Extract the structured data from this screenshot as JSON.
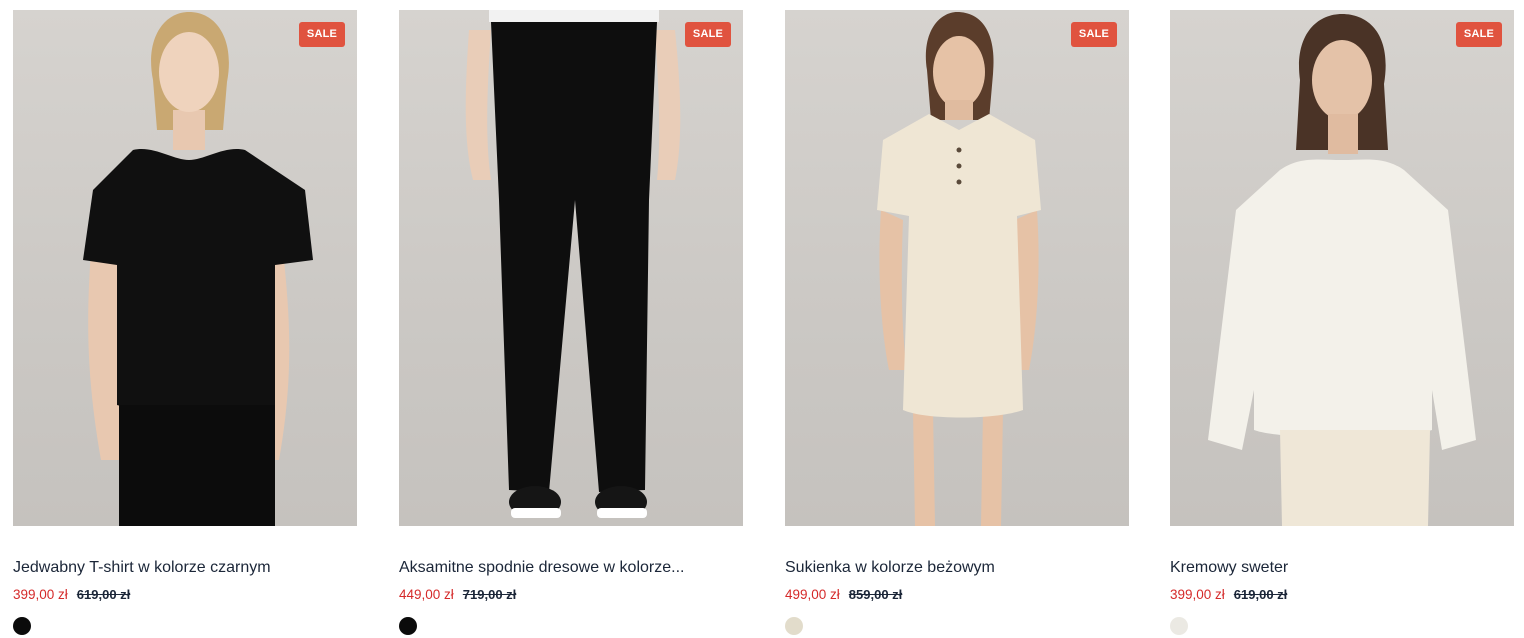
{
  "products": [
    {
      "badge": "SALE",
      "name": "Jedwabny T-shirt w kolorze czarnym",
      "price_current": "399,00 zł",
      "price_old": "619,00 zł",
      "swatch_color": "#0b0b0b"
    },
    {
      "badge": "SALE",
      "name": "Aksamitne spodnie dresowe w kolorze...",
      "price_current": "449,00 zł",
      "price_old": "719,00 zł",
      "swatch_color": "#0b0b0b"
    },
    {
      "badge": "SALE",
      "name": "Sukienka w kolorze beżowym",
      "price_current": "499,00 zł",
      "price_old": "859,00 zł",
      "swatch_color": "#e2dccb"
    },
    {
      "badge": "SALE",
      "name": "Kremowy sweter",
      "price_current": "399,00 zł",
      "price_old": "619,00 zł",
      "swatch_color": "#ebe9e3"
    }
  ],
  "colors": {
    "sale_badge": "#e0533f",
    "price_current": "#d52a2a",
    "text": "#1b2638"
  }
}
